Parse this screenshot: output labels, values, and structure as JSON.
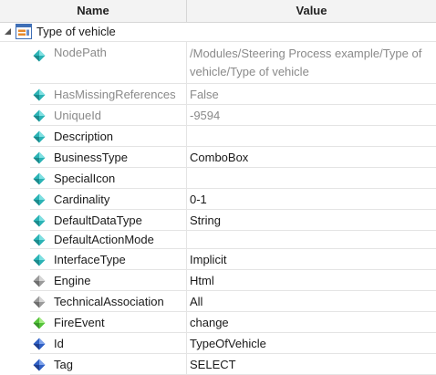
{
  "header": {
    "name": "Name",
    "value": "Value"
  },
  "root": {
    "label": "Type of vehicle"
  },
  "rows": [
    {
      "name": "NodePath",
      "value": "/Modules/Steering Process example/Type of vehicle/Type of vehicle",
      "readonly": true,
      "icon": "teal-diamond-icon"
    },
    {
      "name": "HasMissingReferences",
      "value": "False",
      "readonly": true,
      "icon": "teal-diamond-icon"
    },
    {
      "name": "UniqueId",
      "value": "-9594",
      "readonly": true,
      "icon": "teal-diamond-icon"
    },
    {
      "name": "Description",
      "value": "",
      "readonly": false,
      "icon": "teal-diamond-icon"
    },
    {
      "name": "BusinessType",
      "value": "ComboBox",
      "readonly": false,
      "icon": "teal-diamond-icon"
    },
    {
      "name": "SpecialIcon",
      "value": "",
      "readonly": false,
      "icon": "teal-diamond-icon"
    },
    {
      "name": "Cardinality",
      "value": "0-1",
      "readonly": false,
      "icon": "teal-diamond-icon"
    },
    {
      "name": "DefaultDataType",
      "value": "String",
      "readonly": false,
      "icon": "teal-diamond-icon"
    },
    {
      "name": "DefaultActionMode",
      "value": "",
      "readonly": false,
      "icon": "teal-diamond-icon"
    },
    {
      "name": "InterfaceType",
      "value": "Implicit",
      "readonly": false,
      "icon": "teal-diamond-icon"
    },
    {
      "name": "Engine",
      "value": "Html",
      "readonly": false,
      "icon": "gray-diamond-icon"
    },
    {
      "name": "TechnicalAssociation",
      "value": "All",
      "readonly": false,
      "icon": "gray-diamond-icon"
    },
    {
      "name": "FireEvent",
      "value": "change",
      "readonly": false,
      "icon": "green-diamond-icon"
    },
    {
      "name": "Id",
      "value": "TypeOfVehicle",
      "readonly": false,
      "icon": "blue-diamond-icon"
    },
    {
      "name": "Tag",
      "value": "SELECT",
      "readonly": false,
      "icon": "blue-diamond-icon"
    }
  ],
  "colors": {
    "teal": "#2bb3b5",
    "gray": "#9a9a9a",
    "green": "#55c43a",
    "blue": "#2f5fc4",
    "dim_text": "#8a8a8a"
  }
}
